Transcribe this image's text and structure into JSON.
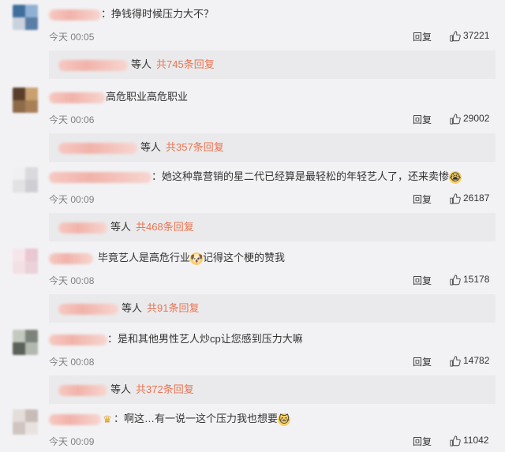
{
  "comments": [
    {
      "text": "挣钱得时候压力大不？",
      "time": "今天 00:05",
      "reply_label": "回复",
      "likes": "37221",
      "replies": {
        "who": "等人",
        "more": "共745条回复"
      }
    },
    {
      "text": "高危职业高危职业",
      "time": "今天 00:06",
      "reply_label": "回复",
      "likes": "29002",
      "replies": {
        "who": "等人",
        "more": "共357条回复"
      }
    },
    {
      "text": "她这种靠营销的星二代已经算是最轻松的年轻艺人了，还来卖惨",
      "time": "今天 00:09",
      "reply_label": "回复",
      "likes": "26187",
      "replies": {
        "who": "等人",
        "more": "共468条回复"
      }
    },
    {
      "text_a": "毕竟艺人是高危行业",
      "text_b": "记得这个梗的赞我",
      "time": "今天 00:08",
      "reply_label": "回复",
      "likes": "15178",
      "replies": {
        "who": "等人",
        "more": "共91条回复"
      }
    },
    {
      "text": "是和其他男性艺人炒cp让您感到压力大嘛",
      "time": "今天 00:08",
      "reply_label": "回复",
      "likes": "14782",
      "replies": {
        "who": "等人",
        "more": "共372条回复"
      }
    },
    {
      "text": "啊这…有一说一这个压力我也想要",
      "time": "今天 00:09",
      "reply_label": "回复",
      "likes": "11042"
    }
  ],
  "icons": {
    "like": "thumbs-up-icon",
    "emoji_crying": "crying-face-icon",
    "emoji_doge": "doge-face-icon",
    "emoji_cat": "cat-face-icon",
    "crown_badge": "crown-icon"
  },
  "colors": {
    "background": "#f2f2f5",
    "reply_box": "#eaeaec",
    "reply_count_link": "#eb7350",
    "meta_text": "#808080"
  }
}
